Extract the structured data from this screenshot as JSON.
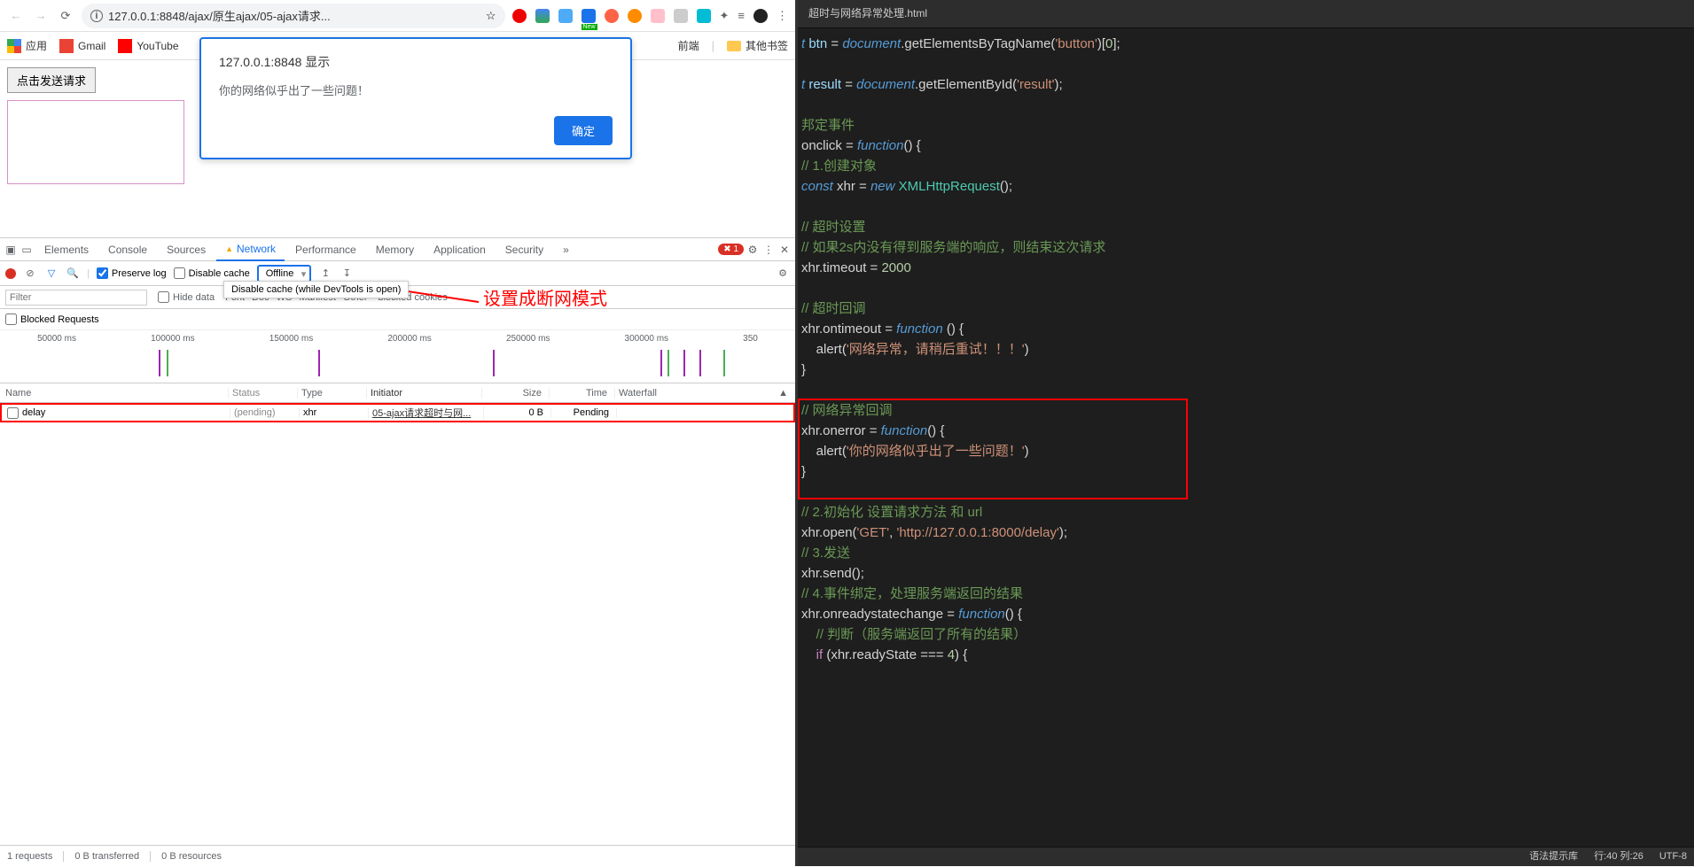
{
  "browser": {
    "address": "127.0.0.1:8848/ajax/原生ajax/05-ajax请求...",
    "bookmarks": {
      "apps": "应用",
      "gmail": "Gmail",
      "youtube": "YouTube",
      "frontend": "前端",
      "other": "其他书签"
    },
    "page": {
      "button_label": "点击发送请求"
    },
    "alert": {
      "title": "127.0.0.1:8848 显示",
      "message": "你的网络似乎出了一些问题！",
      "ok": "确定"
    }
  },
  "devtools": {
    "tabs": {
      "elements": "Elements",
      "console": "Console",
      "sources": "Sources",
      "network": "Network",
      "performance": "Performance",
      "memory": "Memory",
      "application": "Application",
      "security": "Security"
    },
    "error_count": "1",
    "net_toolbar": {
      "preserve": "Preserve log",
      "disable_cache": "Disable cache",
      "throttle": "Offline",
      "tooltip": "Disable cache (while DevTools is open)"
    },
    "filter": {
      "placeholder": "Filter",
      "hide_data": "Hide data",
      "types": [
        "Font",
        "Doc",
        "WS",
        "Manifest",
        "Other"
      ],
      "blocked_cookies": "blocked cookies",
      "blocked_req": "Blocked Requests"
    },
    "annotation": "设置成断网模式",
    "timeline": [
      "50000 ms",
      "100000 ms",
      "150000 ms",
      "200000 ms",
      "250000 ms",
      "300000 ms",
      "350"
    ],
    "table": {
      "headers": {
        "name": "Name",
        "status": "Status",
        "type": "Type",
        "initiator": "Initiator",
        "size": "Size",
        "time": "Time",
        "waterfall": "Waterfall"
      },
      "row": {
        "name": "delay",
        "status": "(pending)",
        "type": "xhr",
        "initiator": "05-ajax请求超时与网...",
        "size": "0 B",
        "time": "Pending"
      }
    },
    "status": {
      "requests": "1 requests",
      "transferred": "0 B transferred",
      "resources": "0 B resources"
    }
  },
  "editor": {
    "tab_title": "超时与网络异常处理.html",
    "status": {
      "syntax": "语法提示库",
      "position": "行:40  列:26",
      "encoding": "UTF-8"
    },
    "code": {
      "l1_a": "t btn = ",
      "l1_b": "document",
      "l1_c": ".getElementsByTagName(",
      "l1_d": "'button'",
      "l1_e": ")[",
      "l1_f": "0",
      "l1_g": "];",
      "l2_a": "t result = ",
      "l2_b": "document",
      "l2_c": ".getElementById(",
      "l2_d": "'result'",
      "l2_e": ");",
      "l3": "邦定事件",
      "l4_a": "onclick = ",
      "l4_b": "function",
      "l4_c": "() {",
      "l5": "// 1.创建对象",
      "l6_a": "const",
      "l6_b": " xhr = ",
      "l6_c": "new",
      "l6_d": " XMLHttpRequest",
      "l6_e": "();",
      "l7": "// 超时设置",
      "l8": "// 如果2s内没有得到服务端的响应，则结束这次请求",
      "l9_a": "xhr.timeout = ",
      "l9_b": "2000",
      "l10": "// 超时回调",
      "l11_a": "xhr.ontimeout = ",
      "l11_b": "function",
      "l11_c": " () {",
      "l12_a": "    alert(",
      "l12_b": "'网络异常，请稍后重试！！！'",
      "l12_c": ")",
      "l13": "}",
      "l14": "// 网络异常回调",
      "l15_a": "xhr.onerror = ",
      "l15_b": "function",
      "l15_c": "() {",
      "l16_a": "    alert(",
      "l16_b": "'你的网络似乎出了一些问题！'",
      "l16_c": ")",
      "l17": "}",
      "l18": "// 2.初始化 设置请求方法 和 url",
      "l19_a": "xhr.open(",
      "l19_b": "'GET'",
      "l19_c": ", ",
      "l19_d": "'http://127.0.0.1:8000/delay'",
      "l19_e": ");",
      "l20": "// 3.发送",
      "l21": "xhr.send();",
      "l22": "// 4.事件绑定，处理服务端返回的结果",
      "l23_a": "xhr.onreadystatechange = ",
      "l23_b": "function",
      "l23_c": "() {",
      "l24": "    // 判断（服务端返回了所有的结果）",
      "l25_a": "    if",
      "l25_b": " (xhr.readyState === ",
      "l25_c": "4",
      "l25_d": ") {"
    }
  }
}
